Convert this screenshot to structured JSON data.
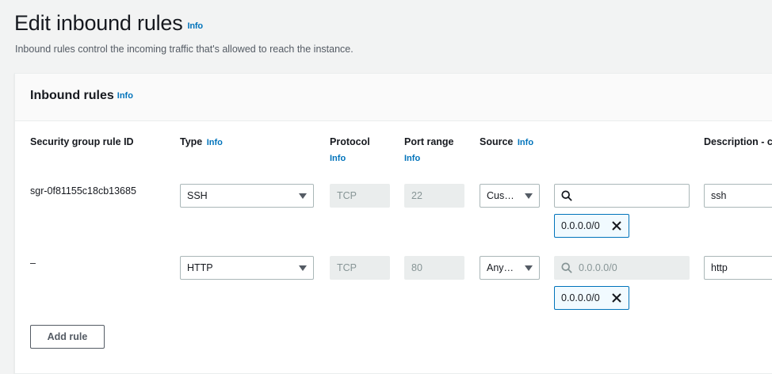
{
  "page": {
    "title": "Edit inbound rules",
    "title_info": "Info",
    "description": "Inbound rules control the incoming traffic that's allowed to reach the instance."
  },
  "panel": {
    "title": "Inbound rules",
    "title_info": "Info",
    "columns": {
      "rule_id": "Security group rule ID",
      "type": "Type",
      "type_info": "Info",
      "protocol": "Protocol",
      "protocol_info": "Info",
      "port_range": "Port range",
      "port_range_info": "Info",
      "source": "Source",
      "source_info": "Info",
      "description": "Description - c"
    },
    "rows": [
      {
        "rule_id": "sgr-0f81155c18cb13685",
        "type": "SSH",
        "protocol": "TCP",
        "port_range": "22",
        "source": "Cus…",
        "source_search_value": "",
        "source_search_placeholder": "",
        "token": "0.0.0.0/0",
        "description": "ssh"
      },
      {
        "rule_id": "–",
        "type": "HTTP",
        "protocol": "TCP",
        "port_range": "80",
        "source": "Any…",
        "source_search_value": "0.0.0.0/0",
        "token": "0.0.0.0/0",
        "description": "http"
      }
    ],
    "add_rule_label": "Add rule"
  },
  "colors": {
    "accent": "#0073bb",
    "background": "#f2f3f3",
    "disabled_fill": "#eaeded"
  }
}
